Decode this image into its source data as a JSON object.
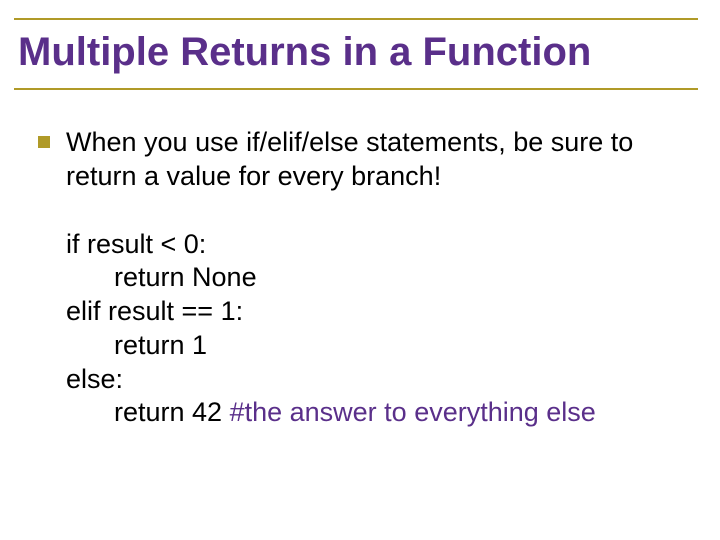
{
  "title": "Multiple Returns in a Function",
  "bullet": "When you use if/elif/else statements, be sure to return a value for every branch!",
  "code": {
    "l1": "if result < 0:",
    "l2": "return None",
    "l3": "elif result == 1:",
    "l4": "return 1",
    "l5": "else:",
    "l6a": "return 42 ",
    "l6b": "#the answer to everything else"
  }
}
